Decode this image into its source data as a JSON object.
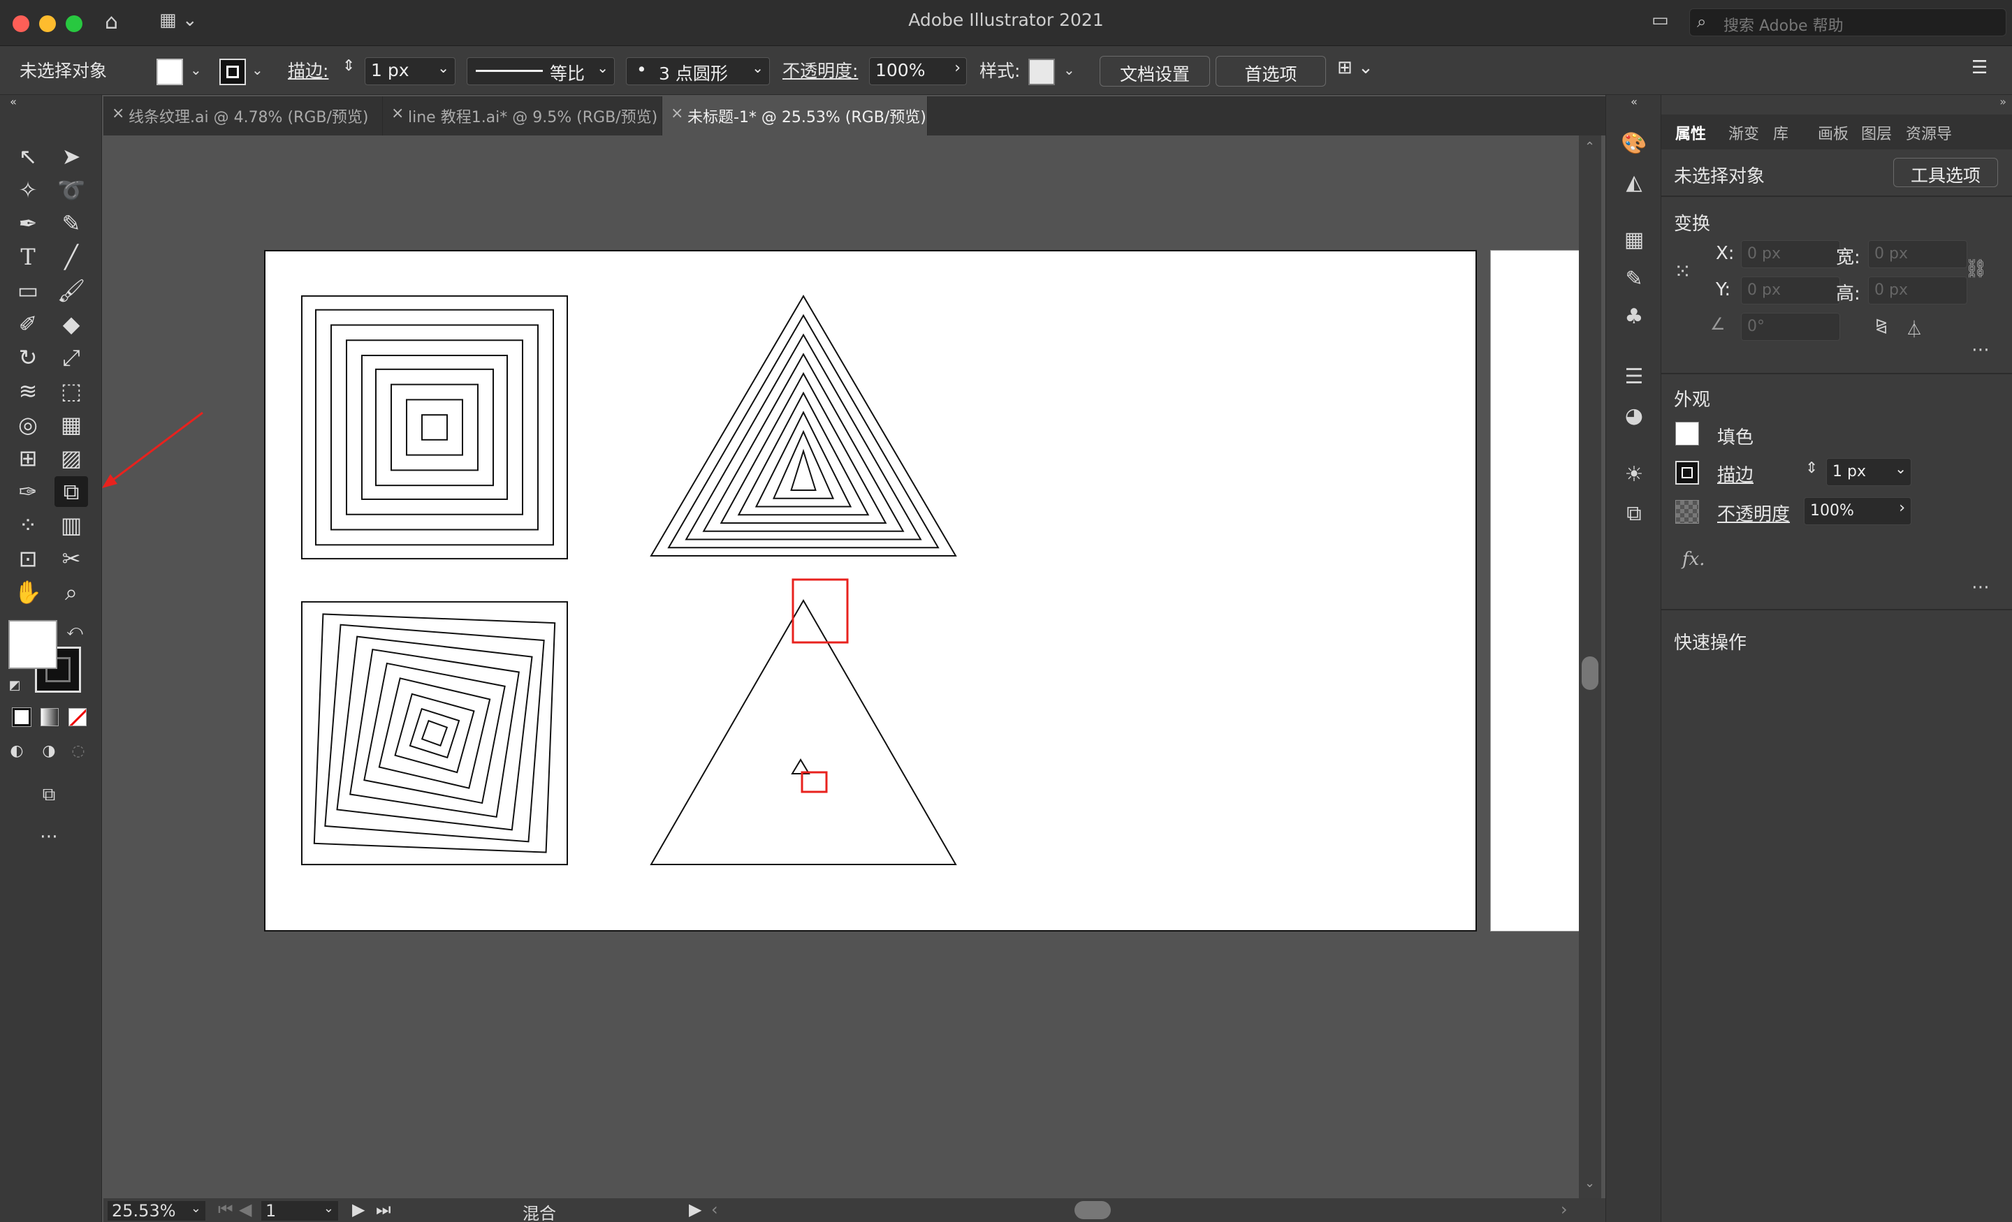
{
  "app": {
    "title": "Adobe Illustrator 2021",
    "search_placeholder": "搜索 Adobe 帮助"
  },
  "control_bar": {
    "selection_status": "未选择对象",
    "stroke_label": "描边:",
    "stroke_weight": "1 px",
    "stroke_profile": "等比",
    "brush": "3 点圆形",
    "opacity_label": "不透明度:",
    "opacity_value": "100%",
    "style_label": "样式:",
    "doc_setup_button": "文档设置",
    "preferences_button": "首选项"
  },
  "tabs": [
    {
      "label": "线条纹理.ai @ 4.78% (RGB/预览)",
      "active": false
    },
    {
      "label": "line 教程1.ai* @ 9.5% (RGB/预览)",
      "active": false
    },
    {
      "label": "未标题-1* @ 25.53% (RGB/预览)",
      "active": true
    }
  ],
  "status_bar": {
    "zoom": "25.53%",
    "artboard_number": "1",
    "current_tool": "混合"
  },
  "panel": {
    "tabs": [
      "属性",
      "渐变",
      "库",
      "画板",
      "图层",
      "资源导"
    ],
    "selection_status": "未选择对象",
    "tool_options_button": "工具选项",
    "transform_title": "变换",
    "x_label": "X:",
    "y_label": "Y:",
    "w_label": "宽:",
    "h_label": "高:",
    "x_value": "0 px",
    "y_value": "0 px",
    "w_value": "0 px",
    "h_value": "0 px",
    "angle_value": "0°",
    "appearance_title": "外观",
    "fill_label": "填色",
    "stroke_label": "描边",
    "stroke_weight": "1 px",
    "opacity_label": "不透明度",
    "opacity_value": "100%",
    "fx_label": "fx.",
    "quick_actions_title": "快速操作"
  },
  "colors": {
    "annotation_red": "#e8221e",
    "artboard_bg": "#ffffff",
    "canvas_bg": "#535353"
  }
}
